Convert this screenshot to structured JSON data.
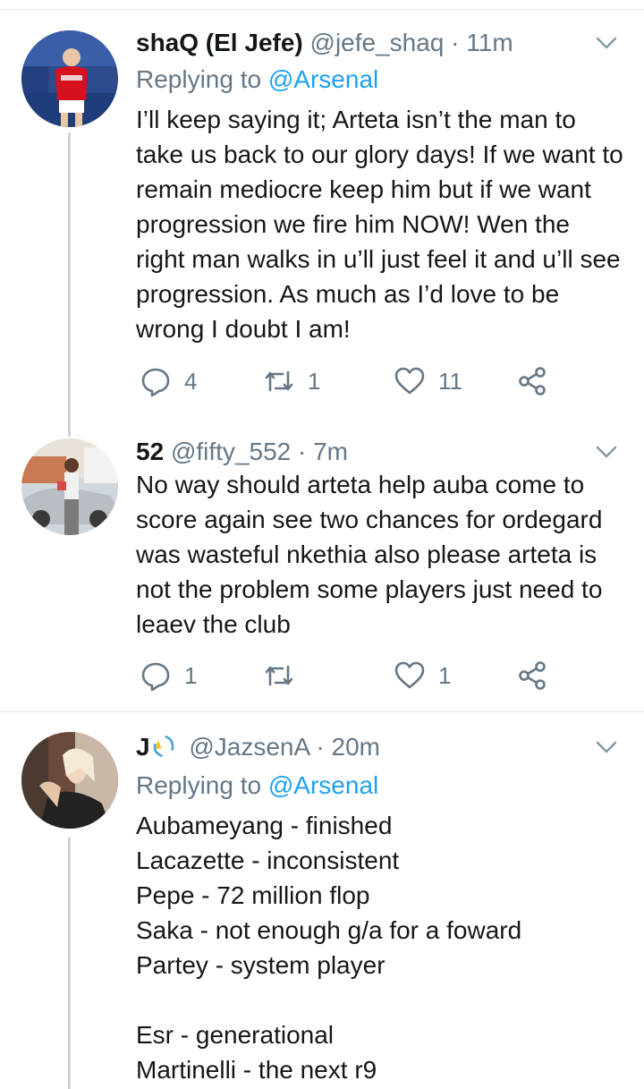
{
  "colors": {
    "link": "#1da1f2",
    "muted": "#657786",
    "text": "#14171a",
    "thread_line": "#ccd6dd"
  },
  "tweets": [
    {
      "display_name": "shaQ (El Jefe)",
      "handle": "@jefe_shaq",
      "separator": "·",
      "time": "11m",
      "replying_prefix": "Replying to",
      "replying_to": "@Arsenal",
      "text": "I’ll keep saying it; Arteta isn’t the man to take us back to our glory days! If we want to remain mediocre keep him but if we want progression we fire him NOW! Wen the right man walks in u’ll just feel it and u’ll see progression. As much as I’d love to be wrong I doubt I am!",
      "replies": "4",
      "retweets": "1",
      "likes": "11"
    },
    {
      "display_name": "52",
      "handle": "@fifty_552",
      "separator": "·",
      "time": "7m",
      "text": "No way should arteta help auba come to score again see two chances for ordegard was wasteful nkethia also please arteta is not the problem some players just need to leaev the club",
      "replies": "1",
      "retweets": "",
      "likes": "1"
    },
    {
      "display_name": "J",
      "handle": "@JazsenA",
      "separator": "·",
      "time": "20m",
      "replying_prefix": "Replying to",
      "replying_to": "@Arsenal",
      "text": "Aubameyang - finished\nLacazette - inconsistent\nPepe - 72 million flop\nSaka - not enough g/a for a foward\nPartey - system player\n\nEsr - generational\nMartinelli - the next r9"
    }
  ],
  "icons": {
    "reply": "reply-icon",
    "retweet": "retweet-icon",
    "like": "heart-icon",
    "share": "share-icon",
    "caret": "chevron-down-icon"
  }
}
